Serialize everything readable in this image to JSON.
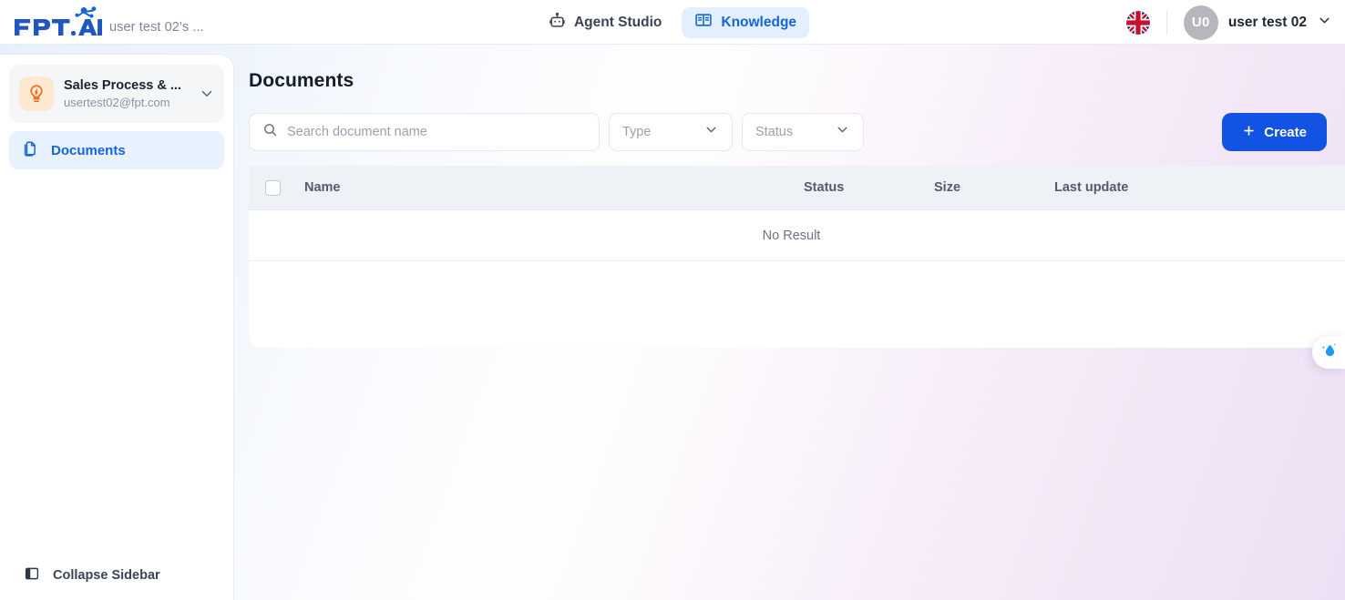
{
  "header": {
    "brand_name": "FPT.AI",
    "workspace_label": "user test 02's ...",
    "nav": [
      {
        "label": "Agent Studio",
        "icon": "robot-icon",
        "active": false
      },
      {
        "label": "Knowledge",
        "icon": "book-icon",
        "active": true
      }
    ],
    "language_icon": "uk-flag-icon",
    "avatar_initials": "U0",
    "user_name": "user test 02",
    "user_menu_icon": "chevron-down-icon"
  },
  "sidebar": {
    "knowledge_base": {
      "icon": "lightbulb-icon",
      "title": "Sales Process & ...",
      "email": "usertest02@fpt.com",
      "chevron_icon": "chevron-down-icon"
    },
    "items": [
      {
        "label": "Documents",
        "icon": "documents-icon",
        "active": true
      }
    ],
    "collapse": {
      "label": "Collapse Sidebar",
      "icon": "panel-collapse-icon"
    }
  },
  "main": {
    "page_title": "Documents",
    "search": {
      "icon": "search-icon",
      "placeholder": "Search document name",
      "value": ""
    },
    "filters": [
      {
        "label": "Type",
        "icon": "chevron-down-icon"
      },
      {
        "label": "Status",
        "icon": "chevron-down-icon"
      }
    ],
    "create_button": {
      "label": "Create",
      "icon": "plus-icon",
      "color": "#1353E3"
    },
    "table": {
      "select_all_checkbox": "unchecked",
      "columns": [
        "Name",
        "Status",
        "Size",
        "Last update"
      ],
      "rows": [],
      "empty_message": "No Result"
    }
  },
  "floating_widget": {
    "icon": "water-drop-sparkle-icon",
    "color": "#1f9cf0"
  },
  "theme": {
    "accent_blue": "#1565D8",
    "create_blue": "#1353E3",
    "active_nav_bg": "#E4EFFD",
    "sidebar_active_bg": "#E8F1FE",
    "kb_icon_bg": "#FDE8D2",
    "kb_icon_color": "#F2691E",
    "table_header_bg": "#EEF1F6"
  }
}
